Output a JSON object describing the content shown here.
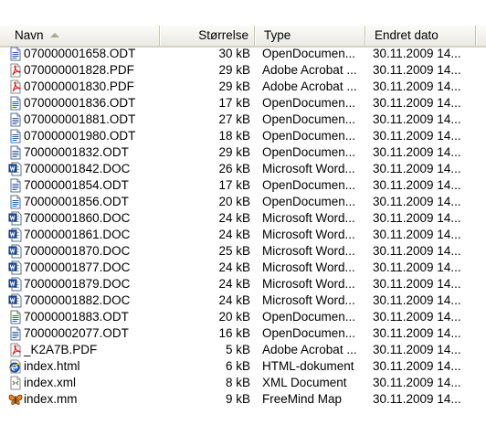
{
  "columns": {
    "name": "Navn",
    "size": "Størrelse",
    "type": "Type",
    "date": "Endret dato"
  },
  "sorted_column": "name",
  "files": [
    {
      "name": "070000001658.ODT",
      "size": "30 kB",
      "type": "OpenDocumen...",
      "date": "30.11.2009 14...",
      "icon": "odt-document-icon"
    },
    {
      "name": "070000001828.PDF",
      "size": "29 kB",
      "type": "Adobe Acrobat ...",
      "date": "30.11.2009 14...",
      "icon": "pdf-document-icon"
    },
    {
      "name": "070000001830.PDF",
      "size": "29 kB",
      "type": "Adobe Acrobat ...",
      "date": "30.11.2009 14...",
      "icon": "pdf-document-icon"
    },
    {
      "name": "070000001836.ODT",
      "size": "17 kB",
      "type": "OpenDocumen...",
      "date": "30.11.2009 14...",
      "icon": "odt-document-icon"
    },
    {
      "name": "070000001881.ODT",
      "size": "27 kB",
      "type": "OpenDocumen...",
      "date": "30.11.2009 14...",
      "icon": "odt-document-icon"
    },
    {
      "name": "070000001980.ODT",
      "size": "18 kB",
      "type": "OpenDocumen...",
      "date": "30.11.2009 14...",
      "icon": "odt-document-icon"
    },
    {
      "name": "70000001832.ODT",
      "size": "29 kB",
      "type": "OpenDocumen...",
      "date": "30.11.2009 14...",
      "icon": "odt-document-icon"
    },
    {
      "name": "70000001842.DOC",
      "size": "26 kB",
      "type": "Microsoft Word...",
      "date": "30.11.2009 14...",
      "icon": "word-document-icon"
    },
    {
      "name": "70000001854.ODT",
      "size": "17 kB",
      "type": "OpenDocumen...",
      "date": "30.11.2009 14...",
      "icon": "odt-document-icon"
    },
    {
      "name": "70000001856.ODT",
      "size": "20 kB",
      "type": "OpenDocumen...",
      "date": "30.11.2009 14...",
      "icon": "odt-document-icon"
    },
    {
      "name": "70000001860.DOC",
      "size": "24 kB",
      "type": "Microsoft Word...",
      "date": "30.11.2009 14...",
      "icon": "word-document-icon"
    },
    {
      "name": "70000001861.DOC",
      "size": "24 kB",
      "type": "Microsoft Word...",
      "date": "30.11.2009 14...",
      "icon": "word-document-icon"
    },
    {
      "name": "70000001870.DOC",
      "size": "25 kB",
      "type": "Microsoft Word...",
      "date": "30.11.2009 14...",
      "icon": "word-document-icon"
    },
    {
      "name": "70000001877.DOC",
      "size": "24 kB",
      "type": "Microsoft Word...",
      "date": "30.11.2009 14...",
      "icon": "word-document-icon"
    },
    {
      "name": "70000001879.DOC",
      "size": "24 kB",
      "type": "Microsoft Word...",
      "date": "30.11.2009 14...",
      "icon": "word-document-icon"
    },
    {
      "name": "70000001882.DOC",
      "size": "24 kB",
      "type": "Microsoft Word...",
      "date": "30.11.2009 14...",
      "icon": "word-document-icon"
    },
    {
      "name": "70000001883.ODT",
      "size": "20 kB",
      "type": "OpenDocumen...",
      "date": "30.11.2009 14...",
      "icon": "odt-document-icon"
    },
    {
      "name": "70000002077.ODT",
      "size": "16 kB",
      "type": "OpenDocumen...",
      "date": "30.11.2009 14...",
      "icon": "odt-document-icon"
    },
    {
      "name": "_K2A7B.PDF",
      "size": "5 kB",
      "type": "Adobe Acrobat ...",
      "date": "30.11.2009 14...",
      "icon": "pdf-document-icon"
    },
    {
      "name": "index.html",
      "size": "6 kB",
      "type": "HTML-dokument",
      "date": "30.11.2009 14...",
      "icon": "html-document-icon"
    },
    {
      "name": "index.xml",
      "size": "8 kB",
      "type": "XML Document",
      "date": "30.11.2009 14...",
      "icon": "xml-document-icon"
    },
    {
      "name": "index.mm",
      "size": "9 kB",
      "type": "FreeMind Map",
      "date": "30.11.2009 14...",
      "icon": "freemind-map-icon"
    }
  ]
}
